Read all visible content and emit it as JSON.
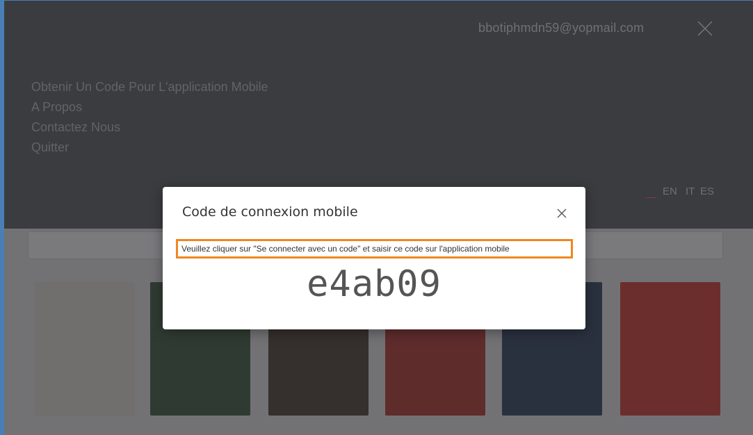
{
  "menu": {
    "email": "bbotiphmdn59@yopmail.com",
    "items": [
      "Obtenir Un Code Pour L'application Mobile",
      "A Propos",
      "Contactez Nous",
      "Quitter"
    ],
    "languages": [
      "EN",
      "IT",
      "ES"
    ],
    "active_language_color": "#7a3f3f"
  },
  "modal": {
    "title": "Code de connexion mobile",
    "instruction": "Veuillez cliquer sur \"Se connecter avec un code\" et saisir ce code sur l'application mobile",
    "code": "e4ab09",
    "highlight_color": "#f0871f"
  },
  "colors": {
    "overlay": "#3b3c40",
    "frame": "#4a7fb5"
  },
  "books": [
    {
      "color": "#e8e2d6"
    },
    {
      "color": "#3a5a3c"
    },
    {
      "color": "#4a3a2e"
    },
    {
      "color": "#b8322b"
    },
    {
      "color": "#2d3f5a"
    },
    {
      "color": "#d8392a"
    }
  ]
}
